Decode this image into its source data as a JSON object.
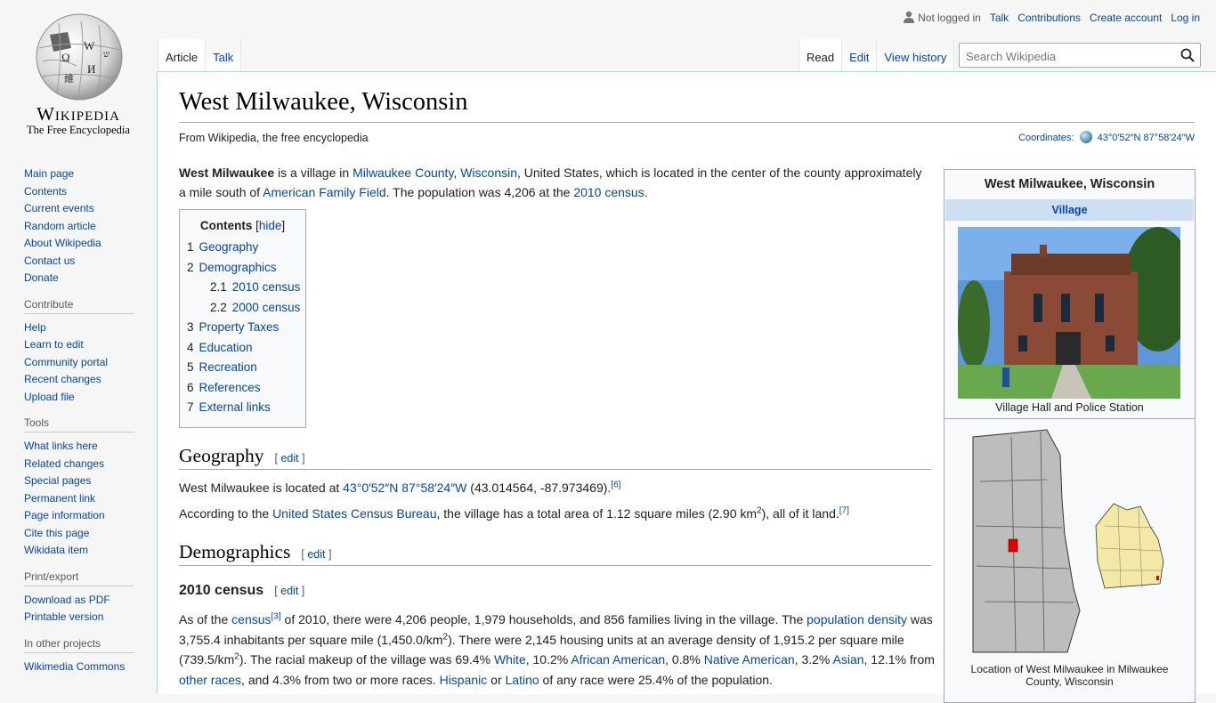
{
  "logo": {
    "wordmark": "Wikipedia",
    "tagline": "The Free Encyclopedia"
  },
  "personal": {
    "not_logged_in": "Not logged in",
    "talk": "Talk",
    "contributions": "Contributions",
    "create_account": "Create account",
    "login": "Log in"
  },
  "tabs": {
    "article": "Article",
    "talk": "Talk",
    "read": "Read",
    "edit": "Edit",
    "history": "View history"
  },
  "search": {
    "placeholder": "Search Wikipedia"
  },
  "sidebar": {
    "nav": [
      "Main page",
      "Contents",
      "Current events",
      "Random article",
      "About Wikipedia",
      "Contact us",
      "Donate"
    ],
    "contribute_head": "Contribute",
    "contribute": [
      "Help",
      "Learn to edit",
      "Community portal",
      "Recent changes",
      "Upload file"
    ],
    "tools_head": "Tools",
    "tools": [
      "What links here",
      "Related changes",
      "Special pages",
      "Permanent link",
      "Page information",
      "Cite this page",
      "Wikidata item"
    ],
    "print_head": "Print/export",
    "print": [
      "Download as PDF",
      "Printable version"
    ],
    "projects_head": "In other projects",
    "projects": [
      "Wikimedia Commons"
    ]
  },
  "page": {
    "title": "West Milwaukee, Wisconsin",
    "from": "From Wikipedia, the free encyclopedia",
    "coords_label": "Coordinates:",
    "coords_value": "43°0′52″N 87°58′24″W"
  },
  "intro": {
    "bold": "West Milwaukee",
    "t1": " is a village in ",
    "l1": "Milwaukee County",
    "t2": ", ",
    "l2": "Wisconsin",
    "t3": ", United States, which is located in the center of the county approximately a mile south of ",
    "l3": "American Family Field",
    "t4": ". The population was 4,206 at the ",
    "l4": "2010 census",
    "t5": "."
  },
  "toc": {
    "title": "Contents",
    "hide": "hide",
    "items": [
      {
        "num": "1",
        "label": "Geography"
      },
      {
        "num": "2",
        "label": "Demographics"
      },
      {
        "num": "2.1",
        "label": "2010 census"
      },
      {
        "num": "2.2",
        "label": "2000 census"
      },
      {
        "num": "3",
        "label": "Property Taxes"
      },
      {
        "num": "4",
        "label": "Education"
      },
      {
        "num": "5",
        "label": "Recreation"
      },
      {
        "num": "6",
        "label": "References"
      },
      {
        "num": "7",
        "label": "External links"
      }
    ]
  },
  "geography": {
    "heading": "Geography",
    "edit": "edit",
    "p1_t1": "West Milwaukee is located at ",
    "p1_link": "43°0′52″N 87°58′24″W",
    "p1_t2": " (43.014564, -87.973469).",
    "p1_ref": "[6]",
    "p2_t1": "According to the ",
    "p2_link": "United States Census Bureau",
    "p2_t2": ", the village has a total area of 1.12 square miles (2.90 km",
    "p2_sup": "2",
    "p2_t3": "), all of it land.",
    "p2_ref": "[7]"
  },
  "demographics": {
    "heading": "Demographics",
    "edit": "edit",
    "sub_heading": "2010 census",
    "sub_edit": "edit",
    "t1": "As of the ",
    "l_census": "census",
    "ref3": "[3]",
    "t2": " of 2010, there were 4,206 people, 1,979 households, and 856 families living in the village. The ",
    "l_density": "population density",
    "t3": " was 3,755.4 inhabitants per square mile (1,450.0/km",
    "sup1": "2",
    "t4": "). There were 2,145 housing units at an average density of 1,915.2 per square mile (739.5/km",
    "sup2": "2",
    "t5": "). The racial makeup of the village was 69.4% ",
    "l_white": "White",
    "t6": ", 10.2% ",
    "l_aa": "African American",
    "t7": ", 0.8% ",
    "l_na": "Native American",
    "t8": ", 3.2% ",
    "l_asian": "Asian",
    "t9": ", 12.1% from ",
    "l_other": "other races",
    "t10": ", and 4.3% from two or more races. ",
    "l_hisp": "Hispanic",
    "t11": " or ",
    "l_lat": "Latino",
    "t12": " of any race were 25.4% of the population."
  },
  "infobox": {
    "title": "West Milwaukee, Wisconsin",
    "type": "Village",
    "photo_caption": "Village Hall and Police Station",
    "map_caption": "Location of West Milwaukee in Milwaukee County, Wisconsin"
  }
}
